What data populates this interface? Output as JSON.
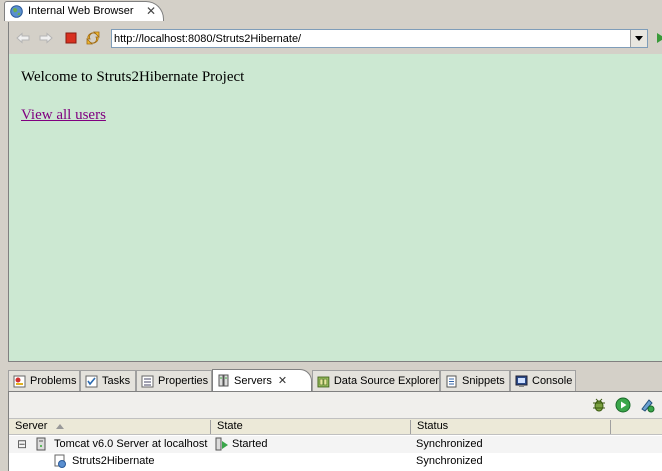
{
  "editor": {
    "tab_title": "Internal Web Browser",
    "tab_icon": "globe-icon"
  },
  "browser": {
    "url": "http://localhost:8080/Struts2Hibernate/",
    "page": {
      "welcome_text": "Welcome to Struts2Hibernate Project",
      "link_text": "View all users",
      "background_color": "#cce8d2",
      "link_color": "#800080"
    }
  },
  "view_tabs": [
    {
      "label": "Problems",
      "icon": "problems-icon"
    },
    {
      "label": "Tasks",
      "icon": "tasks-icon"
    },
    {
      "label": "Properties",
      "icon": "properties-icon"
    },
    {
      "label": "Servers",
      "icon": "servers-icon",
      "active": true
    },
    {
      "label": "Data Source Explorer",
      "icon": "data-source-icon"
    },
    {
      "label": "Snippets",
      "icon": "snippets-icon"
    },
    {
      "label": "Console",
      "icon": "console-icon"
    }
  ],
  "servers": {
    "columns": [
      "Server",
      "State",
      "Status"
    ],
    "rows": [
      {
        "server": "Tomcat v6.0 Server at localhost",
        "state": "Started",
        "status": "Synchronized",
        "expand": "⊟"
      },
      {
        "server": "Struts2Hibernate",
        "state": "",
        "status": "Synchronized"
      }
    ]
  }
}
